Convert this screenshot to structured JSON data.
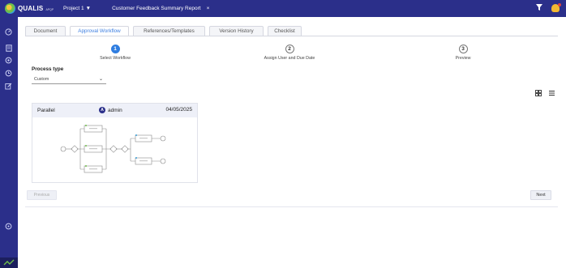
{
  "app": {
    "logo_text": "QUALIS",
    "logo_sub": "APQP",
    "project_label": "Project 1",
    "project_caret": "▼",
    "report_tab_label": "Customer Feedback Summary Report",
    "report_tab_close": "×"
  },
  "tabs": [
    {
      "label": "Document",
      "active": false
    },
    {
      "label": "Approval Workflow",
      "active": true
    },
    {
      "label": "References/Templates",
      "active": false
    },
    {
      "label": "Version History",
      "active": false
    },
    {
      "label": "Checklist",
      "active": false
    }
  ],
  "stepper": {
    "current": 1,
    "steps": [
      {
        "number": "1",
        "label": "Select Workflow"
      },
      {
        "number": "2",
        "label": "Assign User and Due Date"
      },
      {
        "number": "3",
        "label": "Preview"
      }
    ]
  },
  "process_type": {
    "label": "Process type",
    "value": "Custom",
    "chevron": "⌄"
  },
  "view_toggle": {
    "grid_icon": "grid-icon",
    "list_icon": "list-icon"
  },
  "workflow_card": {
    "type": "Parallel",
    "user_initial": "A",
    "user": "admin",
    "date": "04/05/2025"
  },
  "buttons": {
    "previous": "Previous",
    "next": "Next"
  },
  "colors": {
    "nav_bg": "#2b2f8a",
    "accent": "#2f7de0",
    "active_tab_text": "#3b7de0"
  }
}
